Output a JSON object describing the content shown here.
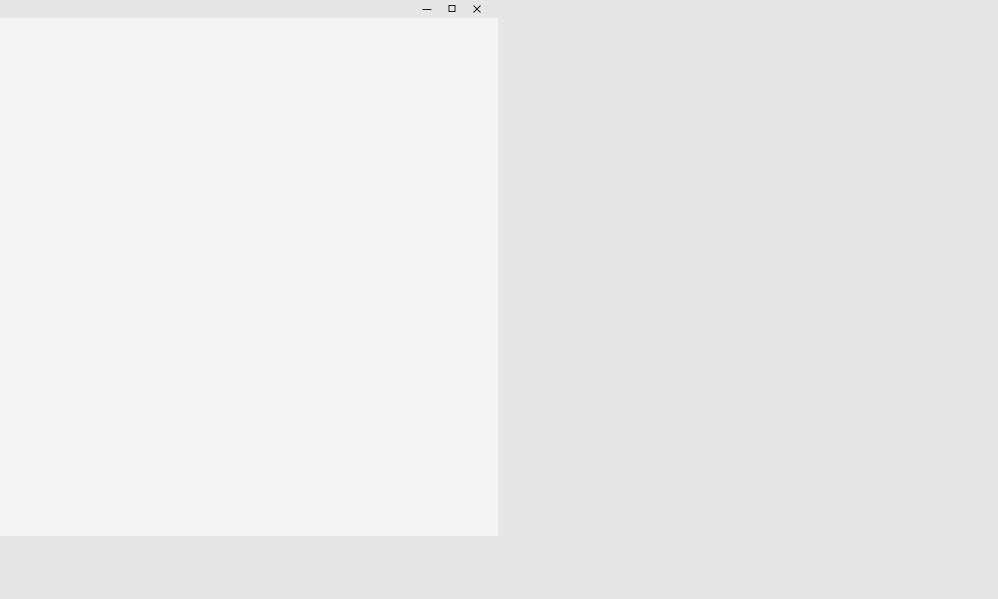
{
  "window": {
    "title": "",
    "buttons": {
      "minimize": "minimize-icon",
      "maximize": "maximize-icon",
      "close": "close-icon"
    }
  },
  "colors": {
    "desktop": "#e6e6e6",
    "titlebar": "#e6e6e6",
    "client": "#f4f4f4",
    "glyph": "#1a1a1a"
  }
}
